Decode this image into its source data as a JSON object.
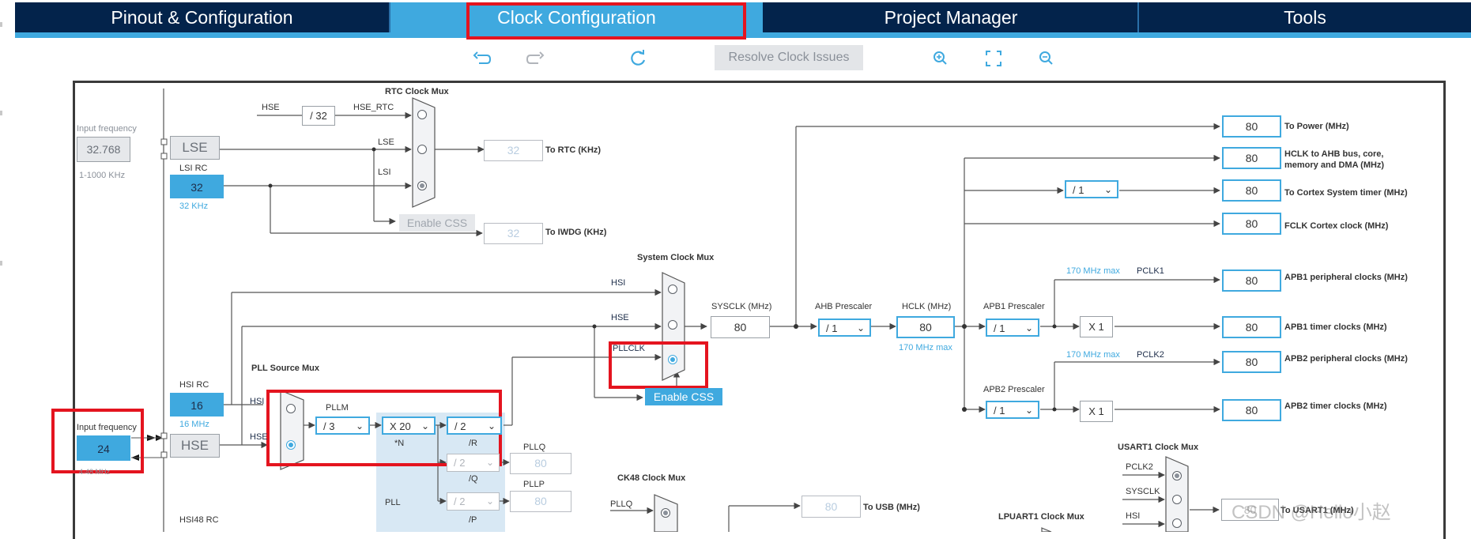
{
  "tabs": [
    {
      "label": "Pinout & Configuration",
      "active": false
    },
    {
      "label": "Clock Configuration",
      "active": true
    },
    {
      "label": "Project Manager",
      "active": false
    },
    {
      "label": "Tools",
      "active": false
    }
  ],
  "toolbar": {
    "undo_icon": "undo-icon",
    "redo_icon": "redo-icon",
    "reset_icon": "refresh-icon",
    "resolve_label": "Resolve Clock Issues",
    "zoom_in_icon": "zoom-in-icon",
    "fit_icon": "fit-screen-icon",
    "zoom_out_icon": "zoom-out-icon"
  },
  "colors": {
    "accent": "#3fa9df",
    "nav": "#03234b",
    "highlight": "#e4141f"
  },
  "left": {
    "input_freq_label": "Input frequency",
    "lse_input_value": "32.768",
    "lse_range": "1-1000 KHz",
    "lse_label": "LSE",
    "lsi_rc_label": "LSI RC",
    "lsi_value": "32",
    "lsi_unit": "32 KHz",
    "hsi_rc_label": "HSI RC",
    "hsi_value": "16",
    "hsi_unit": "16 MHz",
    "hse_input_label": "Input frequency",
    "hse_input_value": "24",
    "hse_range": "4-48 MHz",
    "hse_label": "HSE",
    "hsi48_label": "HSI48 RC"
  },
  "rtc": {
    "mux_title": "RTC Clock Mux",
    "hse_label": "HSE",
    "div_value": "/ 32",
    "hse_rtc_label": "HSE_RTC",
    "lse_label": "LSE",
    "lsi_label": "LSI",
    "rtc_value": "32",
    "rtc_label": "To RTC (KHz)",
    "enable_css": "Enable CSS",
    "iwdg_value": "32",
    "iwdg_label": "To IWDG (KHz)"
  },
  "pll": {
    "source_mux_title": "PLL Source Mux",
    "hsi_label": "HSI",
    "hse_label": "HSE",
    "pllm_label": "PLLM",
    "pllm_value": "/ 3",
    "n_value": "X 20",
    "n_label": "*N",
    "r_value": "/ 2",
    "r_label": "/R",
    "q_value": "/ 2",
    "q_label": "/Q",
    "p_value": "/ 2",
    "p_label": "/P",
    "pllq_label": "PLLQ",
    "pllq_value": "80",
    "pllp_label": "PLLP",
    "pllp_value": "80",
    "pll_label": "PLL"
  },
  "sys": {
    "mux_title": "System Clock Mux",
    "hsi_label": "HSI",
    "hse_label": "HSE",
    "pllclk_label": "PLLCLK",
    "enable_css": "Enable CSS",
    "sysclk_label": "SYSCLK (MHz)",
    "sysclk_value": "80",
    "ahb_label": "AHB Prescaler",
    "ahb_value": "/ 1",
    "hclk_label": "HCLK (MHz)",
    "hclk_value": "80",
    "hclk_max": "170 MHz max",
    "apb1_label": "APB1 Prescaler",
    "apb1_value": "/ 1",
    "apb2_label": "APB2 Prescaler",
    "apb2_value": "/ 1",
    "cortex_div": "/ 1",
    "x1_a": "X 1",
    "x1_b": "X 1",
    "pclk1_max": "170 MHz max",
    "pclk1_label": "PCLK1",
    "pclk2_max": "170 MHz max",
    "pclk2_label": "PCLK2"
  },
  "outputs": [
    {
      "value": "80",
      "label": "To Power (MHz)"
    },
    {
      "value": "80",
      "label": "HCLK to AHB bus, core,",
      "label2": "memory and DMA (MHz)"
    },
    {
      "value": "80",
      "label": "To Cortex System timer (MHz)"
    },
    {
      "value": "80",
      "label": "FCLK Cortex clock (MHz)"
    },
    {
      "value": "80",
      "label": "APB1 peripheral clocks (MHz)"
    },
    {
      "value": "80",
      "label": "APB1 timer clocks (MHz)"
    },
    {
      "value": "80",
      "label": "APB2 peripheral clocks (MHz)"
    },
    {
      "value": "80",
      "label": "APB2 timer clocks (MHz)"
    }
  ],
  "bottom": {
    "ck48_title": "CK48 Clock Mux",
    "pllq_label": "PLLQ",
    "usb_value": "80",
    "usb_label": "To USB (MHz)",
    "lpuart_title": "LPUART1 Clock Mux",
    "usart1_title": "USART1 Clock Mux",
    "pclk2_label": "PCLK2",
    "sysclk_label": "SYSCLK",
    "hsi_label": "HSI",
    "usart_value": "80",
    "usart_label": "To USART1 (MHz)"
  },
  "watermark": "CSDN @Hello小赵"
}
